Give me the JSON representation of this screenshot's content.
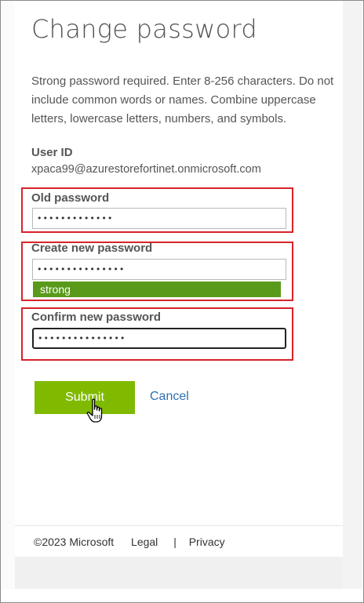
{
  "page": {
    "title": "Change password",
    "description": "Strong password required. Enter 8-256 characters. Do not include common words or names. Combine uppercase letters, lowercase letters, numbers, and symbols."
  },
  "user": {
    "label": "User ID",
    "value": "xpaca99@azurestorefortinet.onmicrosoft.com"
  },
  "fields": {
    "old_password": {
      "label": "Old password",
      "value": "•••••••••••••"
    },
    "new_password": {
      "label": "Create new password",
      "value": "•••••••••••••••",
      "strength": "strong"
    },
    "confirm_password": {
      "label": "Confirm new password",
      "value": "•••••••••••••••"
    }
  },
  "actions": {
    "submit": "Submit",
    "cancel": "Cancel"
  },
  "footer": {
    "copyright": "©2023 Microsoft",
    "legal": "Legal",
    "separator": "|",
    "privacy": "Privacy"
  },
  "colors": {
    "accent_green": "#7fba00",
    "strength_green": "#5a9a1a",
    "highlight_red": "#d8232a",
    "link_blue": "#2f6fb3"
  }
}
